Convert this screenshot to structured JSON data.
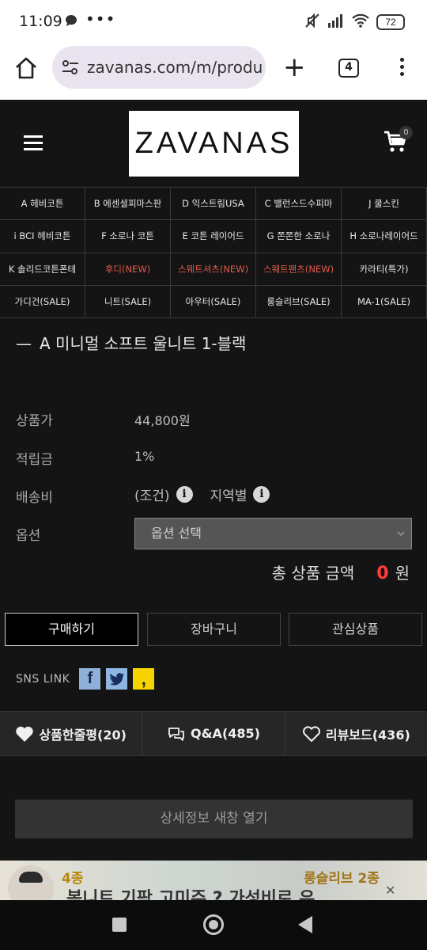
{
  "status_bar": {
    "time": "11:09",
    "dots": "•••",
    "battery": "72"
  },
  "browser": {
    "url": "zavanas.com/m/produ",
    "plus": "+",
    "tab_count": "4"
  },
  "site": {
    "logo": "ZAVANAS",
    "cart_count": "0",
    "categories": [
      {
        "label": "A 헤비코튼",
        "red": false
      },
      {
        "label": "B 에센셜피마스판",
        "red": false
      },
      {
        "label": "D 익스트림USA",
        "red": false
      },
      {
        "label": "C 밸런스드수피마",
        "red": false
      },
      {
        "label": "J 쿨스킨",
        "red": false
      },
      {
        "label": "i BCI 헤비코튼",
        "red": false
      },
      {
        "label": "F 소로나 코튼",
        "red": false
      },
      {
        "label": "E 코튼 레이어드",
        "red": false
      },
      {
        "label": "G 쫀쫀한 소로나",
        "red": false
      },
      {
        "label": "H 소로나레이어드",
        "red": false
      },
      {
        "label": "K 솔리드코튼폰테",
        "red": false
      },
      {
        "label": "후디(NEW)",
        "red": true
      },
      {
        "label": "스웨트셔츠(NEW)",
        "red": true
      },
      {
        "label": "스웨트팬츠(NEW)",
        "red": true
      },
      {
        "label": "카라티(특가)",
        "red": false
      },
      {
        "label": "가디건(SALE)",
        "red": false
      },
      {
        "label": "니트(SALE)",
        "red": false
      },
      {
        "label": "아우터(SALE)",
        "red": false
      },
      {
        "label": "롱슬리브(SALE)",
        "red": false
      },
      {
        "label": "MA-1(SALE)",
        "red": false
      }
    ]
  },
  "product": {
    "dash": "—",
    "title": "A 미니멀 소프트 울니트 1-블랙",
    "price_label": "상품가",
    "price_value": "44,800원",
    "points_label": "적립금",
    "points_value": "1%",
    "shipping_label": "배송비",
    "shipping_value_1": "(조건)",
    "shipping_value_2": "지역별",
    "info_glyph": "i",
    "option_label": "옵션",
    "option_placeholder": "옵션 선택",
    "total_label": "총 상품 금액",
    "total_amount": "0",
    "total_unit": "원"
  },
  "actions": {
    "buy": "구매하기",
    "cart": "장바구니",
    "wish": "관심상품"
  },
  "sns": {
    "label": "SNS LINK",
    "facebook": "f",
    "twitter": "t",
    "kakao": ","
  },
  "review_tabs": [
    {
      "label": "상품한줄평(20)"
    },
    {
      "label": "Q&A(485)"
    },
    {
      "label": "리뷰보드(436)"
    }
  ],
  "detail_button": "상세정보 새창 열기",
  "banner": {
    "tag_left": "4종",
    "headline": "봄니트 기팍 고미주 ? 가성비로 유",
    "tag_right": "롱슬리브 2종",
    "close": "✕"
  },
  "colors": {
    "background": "#141414",
    "accent_red": "#ff3d3d",
    "category_red": "#e35a4a"
  }
}
